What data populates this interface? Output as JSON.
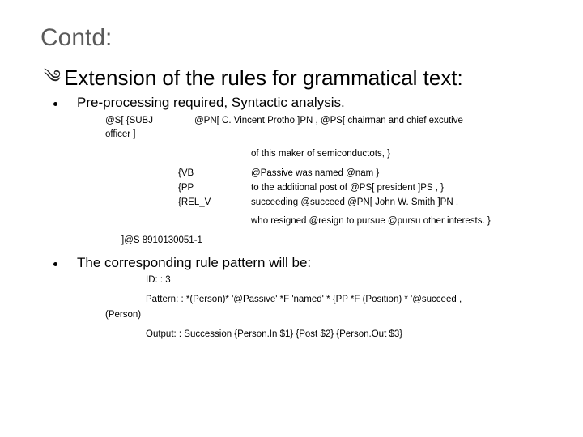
{
  "title": "Contd:",
  "heading": "Extension of the rules for grammatical text:",
  "bullet1": "Pre-processing required, Syntactic analysis.",
  "code1": {
    "l1a": "@S[ {SUBJ",
    "l1b": "@PN[ C. Vincent Protho ]PN , @PS[ chairman and chief excutive",
    "l2": "officer ]",
    "l3": "of this maker of semiconductots, }",
    "r1a": "{VB",
    "r1b": "@Passive was named @nam }",
    "r2a": "{PP",
    "r2b": "to the additional post of @PS[ president ]PS , }",
    "r3a": "{REL_V",
    "r3b": "succeeding @succeed @PN[ John W. Smith ]PN ,",
    "l8": "who resigned @resign to pursue @pursu other interests. }",
    "l9": "]@S 8910130051-1"
  },
  "bullet2": "The corresponding rule pattern will be:",
  "code2": {
    "l1": "ID: : 3",
    "l2a": "Pattern: : *(Person)* '@Passive' *F 'named' * {PP *F (Position) * '@succeed ,",
    "l2b": "(Person)",
    "l3": "Output: : Succession {Person.In $1} {Post $2} {Person.Out $3}"
  }
}
